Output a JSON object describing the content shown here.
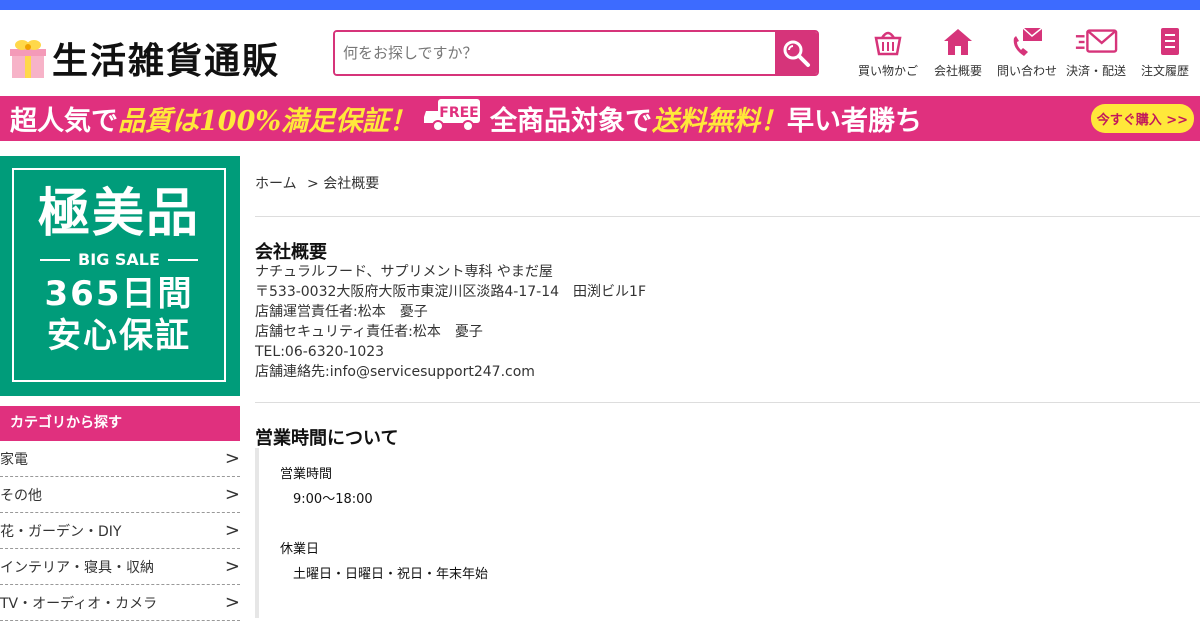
{
  "header": {
    "logo_text": "生活雑貨通販",
    "search_placeholder": "何をお探しですか？",
    "nav": [
      {
        "label": "買い物かご",
        "icon": "cart-icon"
      },
      {
        "label": "会社概要",
        "icon": "home-icon"
      },
      {
        "label": "問い合わせ",
        "icon": "contact-icon"
      },
      {
        "label": "決済・配送",
        "icon": "delivery-icon"
      },
      {
        "label": "注文履歴",
        "icon": "history-icon"
      }
    ]
  },
  "banner": {
    "part1": "超人気で",
    "part2": "品質は100%満足保証！",
    "truck_label": "FREE",
    "part3": "全商品対象で",
    "part4": "送料無料！",
    "part5": "早い者勝ち",
    "button": "今すぐ購入 >>"
  },
  "sale": {
    "line1": "極美品",
    "line2": "BIG SALE",
    "line3": "365日間",
    "line4": "安心保証"
  },
  "categories": {
    "title": "カテゴリから探す",
    "items": [
      "家電",
      "その他",
      "花・ガーデン・DIY",
      "インテリア・寝具・収納",
      "TV・オーディオ・カメラ"
    ],
    "arrow": ">"
  },
  "breadcrumb": {
    "home": "ホーム",
    "current": "> 会社概要"
  },
  "company": {
    "title": "会社概要",
    "lines": [
      "ナチュラルフード、サプリメント専科 やまだ屋",
      "〒533-0032大阪府大阪市東淀川区淡路4-17-14　田渕ビル1F",
      "店舗運営責任者:松本　憂子",
      "店舗セキュリティ責任者:松本　憂子",
      "TEL:06-6320-1023",
      "店舗連絡先:info@servicesupport247.com"
    ]
  },
  "hours": {
    "title": "営業時間について",
    "open_label": "営業時間",
    "open_value": "9:00～18:00",
    "closed_label": "休業日",
    "closed_value": "土曜日・日曜日・祝日・年末年始"
  },
  "colors": {
    "brand_pink": "#e0307e",
    "top_blue": "#3d6bff",
    "sale_green": "#009c7a",
    "banner_yellow": "#ffe83a"
  }
}
